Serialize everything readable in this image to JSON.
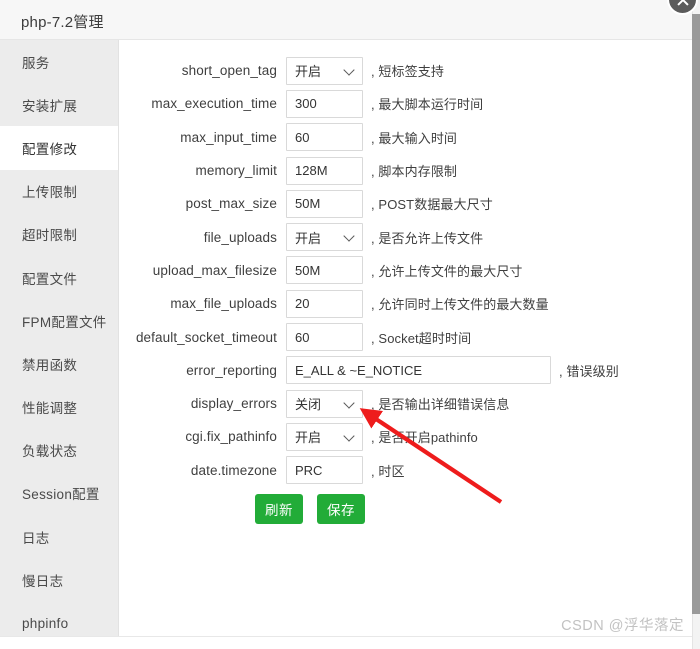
{
  "window": {
    "title": "php-7.2管理",
    "close_icon": "close-icon"
  },
  "sidebar": {
    "items": [
      {
        "label": "服务",
        "active": false
      },
      {
        "label": "安装扩展",
        "active": false
      },
      {
        "label": "配置修改",
        "active": true
      },
      {
        "label": "上传限制",
        "active": false
      },
      {
        "label": "超时限制",
        "active": false
      },
      {
        "label": "配置文件",
        "active": false
      },
      {
        "label": "FPM配置文件",
        "active": false
      },
      {
        "label": "禁用函数",
        "active": false
      },
      {
        "label": "性能调整",
        "active": false
      },
      {
        "label": "负载状态",
        "active": false
      },
      {
        "label": "Session配置",
        "active": false
      },
      {
        "label": "日志",
        "active": false
      },
      {
        "label": "慢日志",
        "active": false
      },
      {
        "label": "phpinfo",
        "active": false
      }
    ]
  },
  "form": {
    "rows": [
      {
        "label": "short_open_tag",
        "type": "select",
        "value": "开启",
        "desc": ", 短标签支持"
      },
      {
        "label": "max_execution_time",
        "type": "input",
        "value": "300",
        "desc": ", 最大脚本运行时间"
      },
      {
        "label": "max_input_time",
        "type": "input",
        "value": "60",
        "desc": ", 最大输入时间"
      },
      {
        "label": "memory_limit",
        "type": "input",
        "value": "128M",
        "desc": ", 脚本内存限制"
      },
      {
        "label": "post_max_size",
        "type": "input",
        "value": "50M",
        "desc": ", POST数据最大尺寸"
      },
      {
        "label": "file_uploads",
        "type": "select",
        "value": "开启",
        "desc": ", 是否允许上传文件"
      },
      {
        "label": "upload_max_filesize",
        "type": "input",
        "value": "50M",
        "desc": ", 允许上传文件的最大尺寸"
      },
      {
        "label": "max_file_uploads",
        "type": "input",
        "value": "20",
        "desc": ", 允许同时上传文件的最大数量"
      },
      {
        "label": "default_socket_timeout",
        "type": "input",
        "value": "60",
        "desc": ", Socket超时时间"
      },
      {
        "label": "error_reporting",
        "type": "input",
        "value": "E_ALL & ~E_NOTICE",
        "desc": ", 错误级别",
        "wide": true
      },
      {
        "label": "display_errors",
        "type": "select",
        "value": "关闭",
        "desc": ", 是否输出详细错误信息"
      },
      {
        "label": "cgi.fix_pathinfo",
        "type": "select",
        "value": "开启",
        "desc": ", 是否开启pathinfo"
      },
      {
        "label": "date.timezone",
        "type": "input",
        "value": "PRC",
        "desc": ", 时区"
      }
    ],
    "buttons": [
      {
        "label": "刷新",
        "name": "refresh-button"
      },
      {
        "label": "保存",
        "name": "save-button"
      }
    ]
  },
  "annotation": {
    "arrow_color": "#ee1c1c"
  },
  "watermark": {
    "text": "CSDN @浮华落定"
  },
  "colors": {
    "accent_green": "#22ac38",
    "sidebar_bg": "#ececec",
    "header_bg": "#f7f7f7"
  }
}
